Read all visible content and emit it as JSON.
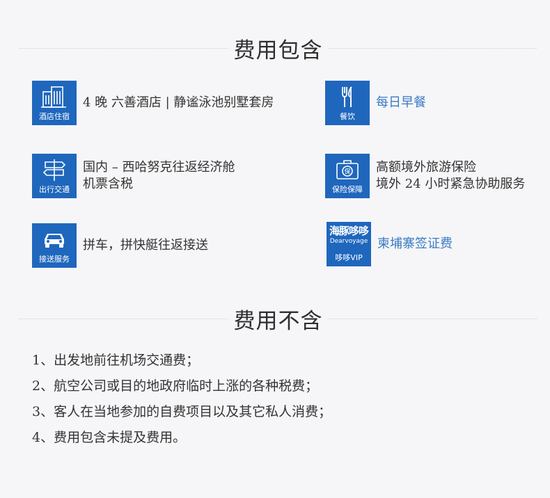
{
  "included": {
    "title": "费用包含",
    "items": [
      {
        "icon": "hotel-icon",
        "caption": "酒店住宿",
        "lines": [
          "4 晚 六善酒店 | 静谧泳池别墅套房"
        ]
      },
      {
        "icon": "dining-icon",
        "caption": "餐饮",
        "lines": [
          "每日早餐"
        ]
      },
      {
        "icon": "signpost-icon",
        "caption": "出行交通",
        "lines": [
          "国内 – 西哈努克往返经济舱",
          "机票含税"
        ]
      },
      {
        "icon": "insurance-icon",
        "caption": "保险保障",
        "lines": [
          "高额境外旅游保险",
          "境外 24 小时紧急协助服务"
        ]
      },
      {
        "icon": "car-icon",
        "caption": "接送服务",
        "lines": [
          "拼车，拼快艇往返接送"
        ]
      },
      {
        "icon": "brand-logo-icon",
        "caption": "哆哆VIP",
        "logo_cn": "海豚哆哆",
        "logo_en": "Dearvoyage",
        "lines": [
          "柬埔寨签证费"
        ]
      }
    ]
  },
  "excluded": {
    "title": "费用不含",
    "items": [
      "1、出发地前往机场交通费；",
      "2、航空公司或目的地政府临时上涨的各种税费；",
      "3、客人在当地参加的自费项目以及其它私人消费；",
      "4、费用包含未提及费用。"
    ]
  },
  "colors": {
    "icon_bg": "#1f67bd",
    "accent_text": "#3a7ac4",
    "background": "#f6f6f8"
  }
}
